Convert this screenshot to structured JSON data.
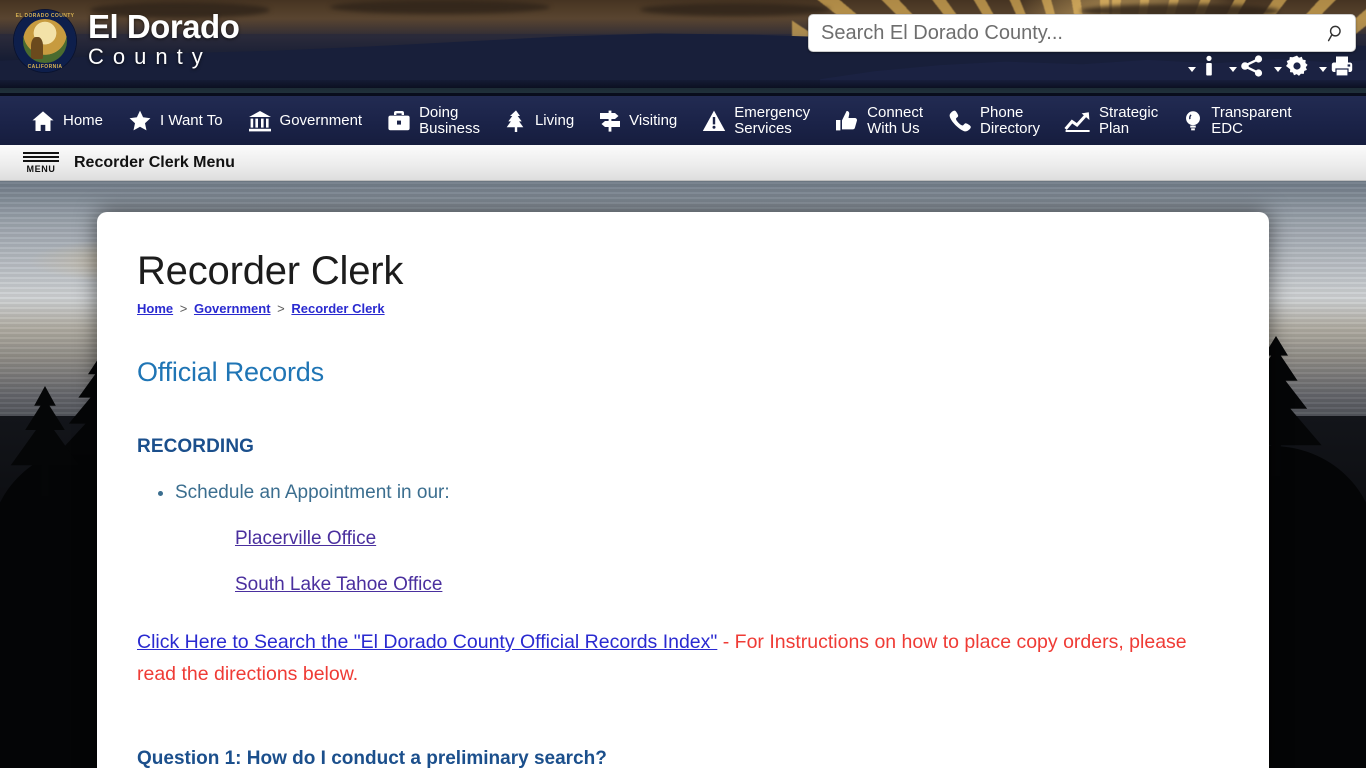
{
  "site": {
    "logo_alt": "El Dorado County Seal",
    "seal_top_text": "EL DORADO COUNTY",
    "seal_bottom_text": "CALIFORNIA",
    "name_line1": "El Dorado",
    "name_line2": "County"
  },
  "search": {
    "placeholder": "Search El Dorado County...",
    "value": "",
    "icon": "search-icon"
  },
  "utility_icons": [
    {
      "name": "info-icon",
      "glyph": "i",
      "has_caret": true
    },
    {
      "name": "share-icon",
      "glyph": "share",
      "has_caret": true
    },
    {
      "name": "gear-icon",
      "glyph": "gear",
      "has_caret": true
    },
    {
      "name": "print-icon",
      "glyph": "print",
      "has_caret": true
    }
  ],
  "mainnav": [
    {
      "label": "Home",
      "label2": "",
      "icon": "home-icon"
    },
    {
      "label": "I Want To",
      "label2": "",
      "icon": "star-icon"
    },
    {
      "label": "Government",
      "label2": "",
      "icon": "bank-icon"
    },
    {
      "label": "Doing",
      "label2": "Business",
      "icon": "briefcase-icon"
    },
    {
      "label": "Living",
      "label2": "",
      "icon": "tree-icon"
    },
    {
      "label": "Visiting",
      "label2": "",
      "icon": "signpost-icon"
    },
    {
      "label": "Emergency",
      "label2": "Services",
      "icon": "warning-triangle-icon"
    },
    {
      "label": "Connect",
      "label2": "With Us",
      "icon": "thumbs-up-icon"
    },
    {
      "label": "Phone",
      "label2": "Directory",
      "icon": "phone-icon"
    },
    {
      "label": "Strategic",
      "label2": "Plan",
      "icon": "chart-up-icon"
    },
    {
      "label": "Transparent",
      "label2": "EDC",
      "icon": "lightbulb-icon"
    }
  ],
  "menubar": {
    "hamburger_label": "MENU",
    "title": "Recorder Clerk Menu"
  },
  "page": {
    "title": "Recorder Clerk",
    "breadcrumb": [
      {
        "label": "Home"
      },
      {
        "label": "Government"
      },
      {
        "label": "Recorder Clerk"
      }
    ],
    "breadcrumb_separator": ">",
    "section_title": "Official Records",
    "subsection_title": "RECORDING",
    "bullets": [
      "Schedule an Appointment in our:"
    ],
    "office_links": [
      "Placerville Office",
      "South Lake Tahoe Office"
    ],
    "notice": {
      "link_text": "Click Here to Search the \"El Dorado County Official Records Index\"",
      "rest_text": " - For Instructions on how to place copy orders, please read the directions below."
    },
    "question_heading": "Question 1: How do I conduct a preliminary search?"
  },
  "colors": {
    "nav_bg": "#1b2348",
    "menubar_bg": "#ededed",
    "section_blue": "#1f75b5",
    "subsection_blue": "#1b4f8c",
    "link_blue": "#2a2ad0",
    "link_purple": "#4a2f9e",
    "notice_red": "#ef3b35",
    "card_bg": "#ffffff"
  }
}
